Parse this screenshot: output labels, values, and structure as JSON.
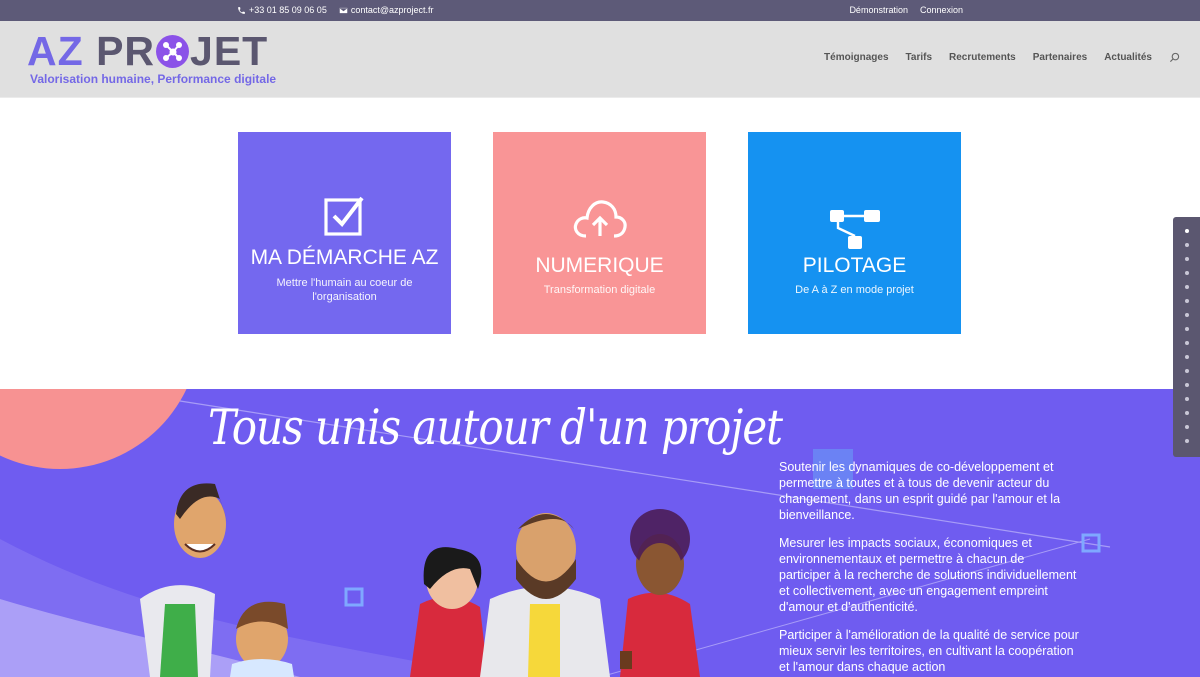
{
  "topbar": {
    "phone": "+33 01 85 09 06 05",
    "email": "contact@azproject.fr",
    "links": [
      "Démonstration",
      "Connexion"
    ]
  },
  "logo": {
    "az": "AZ",
    "pr": "PR",
    "jet": "JET",
    "tagline": "Valorisation humaine, Performance digitale"
  },
  "nav": {
    "items": [
      "Témoignages",
      "Tarifs",
      "Recrutements",
      "Partenaires",
      "Actualités"
    ]
  },
  "cards": [
    {
      "title": "MA DÉMARCHE AZ",
      "subtitle": "Mettre l'humain au coeur de l'organisation",
      "color": "#7468ef",
      "icon": "checkbox-icon"
    },
    {
      "title": "NUMERIQUE",
      "subtitle": "Transformation digitale",
      "color": "#f99596",
      "icon": "cloud-upload-icon"
    },
    {
      "title": "PILOTAGE",
      "subtitle": "De A à Z en mode projet",
      "color": "#1592f1",
      "icon": "sitemap-icon"
    }
  ],
  "hero": {
    "script_title": "Tous unis autour d'un projet",
    "paragraphs": [
      "Soutenir les dynamiques de co-développement et permettre à toutes et à tous de devenir acteur du changement, dans un esprit guidé par l'amour et la bienveillance.",
      "Mesurer les impacts sociaux, économiques et environnementaux et permettre à chacun de participer à la recherche de solutions individuellement et collectivement, avec un engagement empreint d'amour et d'authenticité.",
      "Participer à l'amélioration de la qualité de service pour mieux servir les territoires, en cultivant la coopération et l'amour dans chaque action"
    ]
  },
  "colors": {
    "topbar": "#5d5a78",
    "header": "#e0e0e0",
    "brand_purple": "#7468e6",
    "hero_bg": "#6f5cf0",
    "hero_circle": "#f79292"
  }
}
